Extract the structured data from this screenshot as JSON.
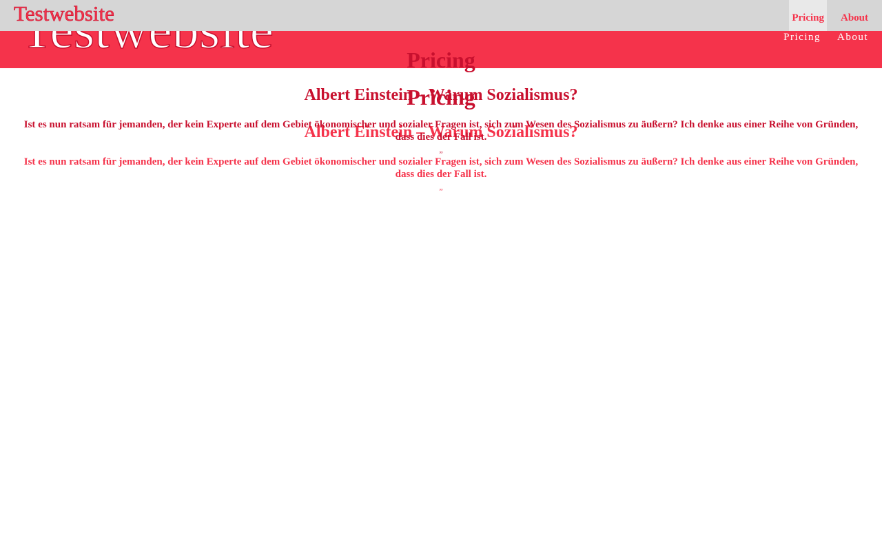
{
  "site": {
    "logo_text": "Testwebsite"
  },
  "nav": {
    "items": [
      {
        "label": "Pricing",
        "active": true
      },
      {
        "label": "About",
        "active": false
      }
    ]
  },
  "main": {
    "page_title": "Pricing",
    "article_heading": "Albert Einstein – Warum Sozialismus?",
    "article_text": "Ist es nun ratsam für jemanden, der kein Experte auf dem Gebiet ökonomischer und sozialer Fragen ist, sich zum Wesen des Sozialismus zu äußern? Ich denke aus einer Reihe von Gründen, dass dies der Fall ist.",
    "closing_mark": "„"
  },
  "colors": {
    "accent": "#f5334b",
    "accent_dark": "#c8102e",
    "header_grey": "#d6d6d6",
    "active_tab": "#e9e9e9",
    "background": "#ffffff"
  }
}
